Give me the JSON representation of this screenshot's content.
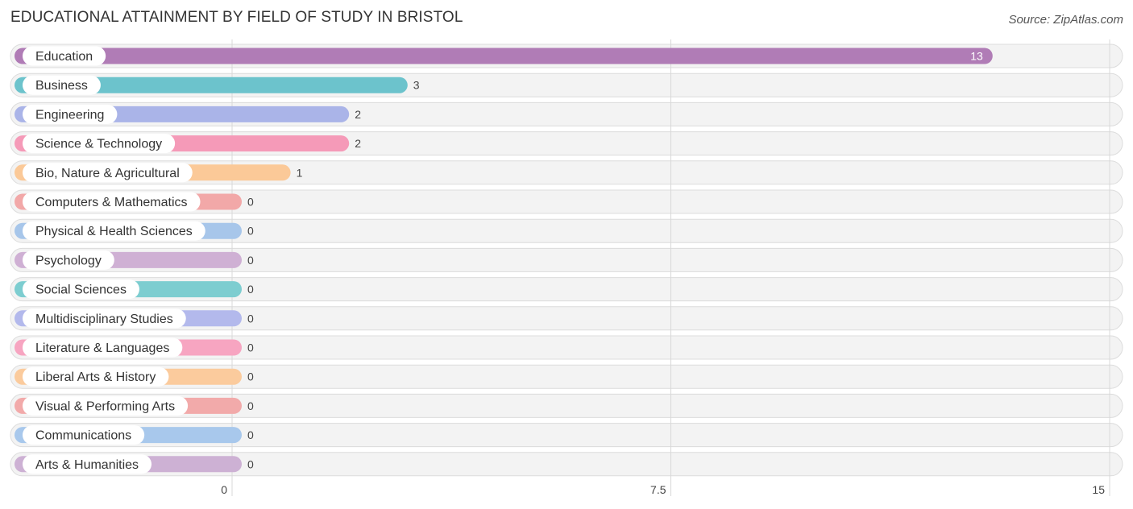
{
  "header": {
    "title": "EDUCATIONAL ATTAINMENT BY FIELD OF STUDY IN BRISTOL",
    "source": "Source: ZipAtlas.com"
  },
  "chart_data": {
    "type": "bar",
    "orientation": "horizontal",
    "title": "EDUCATIONAL ATTAINMENT BY FIELD OF STUDY IN BRISTOL",
    "xlabel": "",
    "ylabel": "",
    "xlim": [
      0,
      15
    ],
    "ticks": [
      0,
      7.5,
      15
    ],
    "tick_labels": [
      "0",
      "7.5",
      "15"
    ],
    "grid": true,
    "categories": [
      "Education",
      "Business",
      "Engineering",
      "Science & Technology",
      "Bio, Nature & Agricultural",
      "Computers & Mathematics",
      "Physical & Health Sciences",
      "Psychology",
      "Social Sciences",
      "Multidisciplinary Studies",
      "Literature & Languages",
      "Liberal Arts & History",
      "Visual & Performing Arts",
      "Communications",
      "Arts & Humanities"
    ],
    "values": [
      13,
      3,
      2,
      2,
      1,
      0,
      0,
      0,
      0,
      0,
      0,
      0,
      0,
      0,
      0
    ],
    "value_labels": [
      "13",
      "3",
      "2",
      "2",
      "1",
      "0",
      "0",
      "0",
      "0",
      "0",
      "0",
      "0",
      "0",
      "0",
      "0"
    ],
    "colors": [
      "#b07cb6",
      "#6cc3cc",
      "#aab4e8",
      "#f59ab8",
      "#fbc998",
      "#f2a8a8",
      "#a7c6ea",
      "#cfb0d4",
      "#7dcdd0",
      "#b3b9ec",
      "#f7a5c1",
      "#fbcb9d",
      "#f2aaaa",
      "#a8c8ec",
      "#cdb1d4"
    ]
  }
}
